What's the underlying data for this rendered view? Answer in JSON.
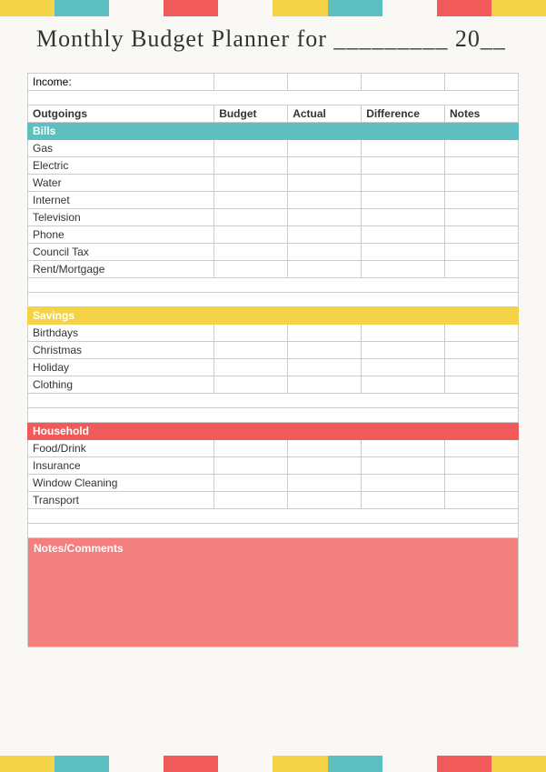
{
  "title": {
    "text": "Monthly Budget Planner for _________ 20__"
  },
  "colors": {
    "teal": "#5dbfbf",
    "yellow": "#f5d347",
    "red": "#f05a5a",
    "white": "#faf8f5"
  },
  "topBar": [
    "yellow",
    "teal",
    "white",
    "red",
    "white",
    "yellow",
    "teal",
    "white",
    "red",
    "yellow"
  ],
  "bottomBar": [
    "yellow",
    "teal",
    "white",
    "red",
    "white",
    "yellow",
    "teal",
    "white",
    "red",
    "yellow"
  ],
  "table": {
    "incomeLabel": "Income:",
    "headers": {
      "outgoings": "Outgoings",
      "budget": "Budget",
      "actual": "Actual",
      "difference": "Difference",
      "notes": "Notes"
    },
    "categories": {
      "bills": {
        "label": "Bills",
        "items": [
          "Gas",
          "Electric",
          "Water",
          "Internet",
          "Television",
          "Phone",
          "Council Tax",
          "Rent/Mortgage"
        ]
      },
      "savings": {
        "label": "Savings",
        "items": [
          "Birthdays",
          "Christmas",
          "Holiday",
          "Clothing"
        ]
      },
      "household": {
        "label": "Household",
        "items": [
          "Food/Drink",
          "Insurance",
          "Window Cleaning",
          "Transport"
        ]
      }
    },
    "notesSection": {
      "label": "Notes/Comments"
    }
  }
}
